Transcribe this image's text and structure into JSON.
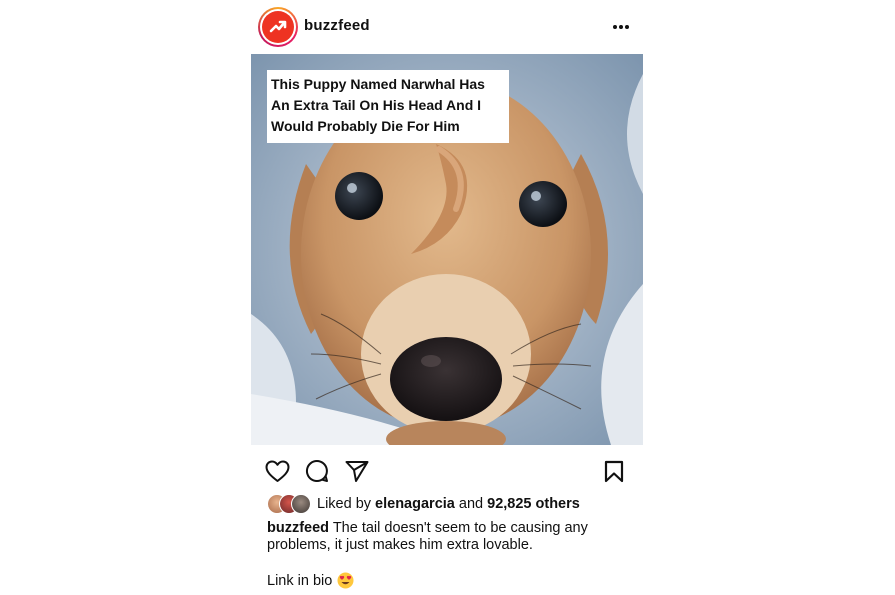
{
  "post": {
    "username": "buzzfeed",
    "headline": "This Puppy Named Narwhal Has\nAn Extra Tail On His Head And I\nWould Probably Die For Him",
    "likes": {
      "prefix": "Liked by",
      "user": "elenagarcia",
      "middle": "and",
      "others": "92,825 others"
    },
    "caption": {
      "user": "buzzfeed",
      "text": "The tail doesn't seem to be causing any problems, it just makes him extra lovable."
    },
    "link_in_bio": "Link in bio"
  },
  "icons": {
    "avatar": "buzzfeed-trending-arrow-icon",
    "more": "more-options-icon",
    "like": "heart-icon",
    "comment": "comment-bubble-icon",
    "share": "paper-plane-icon",
    "save": "bookmark-icon",
    "emoji": "heart-eyes-emoji-icon"
  },
  "colors": {
    "brand_red": "#ee3322",
    "text": "#111111",
    "background": "#ffffff"
  }
}
